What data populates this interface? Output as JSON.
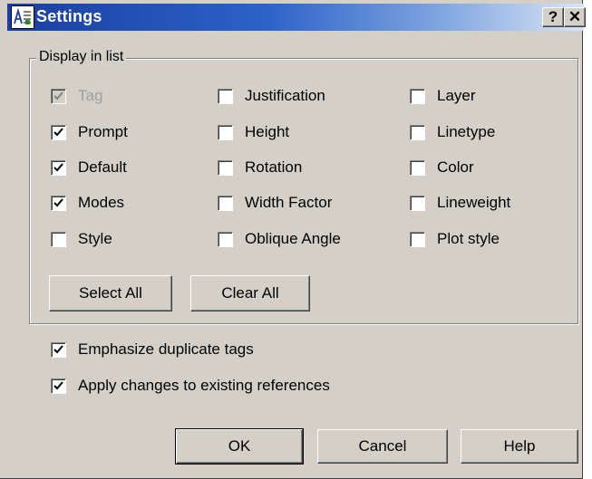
{
  "window": {
    "title": "Settings",
    "help_button": "?",
    "close_button": "✕"
  },
  "display_group": {
    "legend": "Display in list",
    "columns": [
      [
        {
          "label": "Tag",
          "checked": true,
          "disabled": true
        },
        {
          "label": "Prompt",
          "checked": true,
          "disabled": false
        },
        {
          "label": "Default",
          "checked": true,
          "disabled": false
        },
        {
          "label": "Modes",
          "checked": true,
          "disabled": false
        },
        {
          "label": "Style",
          "checked": false,
          "disabled": false
        }
      ],
      [
        {
          "label": "Justification",
          "checked": false,
          "disabled": false
        },
        {
          "label": "Height",
          "checked": false,
          "disabled": false
        },
        {
          "label": "Rotation",
          "checked": false,
          "disabled": false
        },
        {
          "label": "Width Factor",
          "checked": false,
          "disabled": false
        },
        {
          "label": "Oblique Angle",
          "checked": false,
          "disabled": false
        }
      ],
      [
        {
          "label": "Layer",
          "checked": false,
          "disabled": false
        },
        {
          "label": "Linetype",
          "checked": false,
          "disabled": false
        },
        {
          "label": "Color",
          "checked": false,
          "disabled": false
        },
        {
          "label": "Lineweight",
          "checked": false,
          "disabled": false
        },
        {
          "label": "Plot style",
          "checked": false,
          "disabled": false
        }
      ]
    ],
    "select_all_label": "Select All",
    "clear_all_label": "Clear All"
  },
  "options": {
    "emphasize_duplicates": {
      "label": "Emphasize duplicate tags",
      "checked": true
    },
    "apply_changes": {
      "label": "Apply changes to existing references",
      "checked": true
    }
  },
  "buttons": {
    "ok": "OK",
    "cancel": "Cancel",
    "help": "Help"
  },
  "colors": {
    "titlebar_start": "#1a3fa0",
    "face": "#d4d0c8",
    "disabled_text": "#a0a0a0"
  },
  "icons": {
    "app": "autocad-attribute-icon",
    "check": "checkmark-icon"
  }
}
